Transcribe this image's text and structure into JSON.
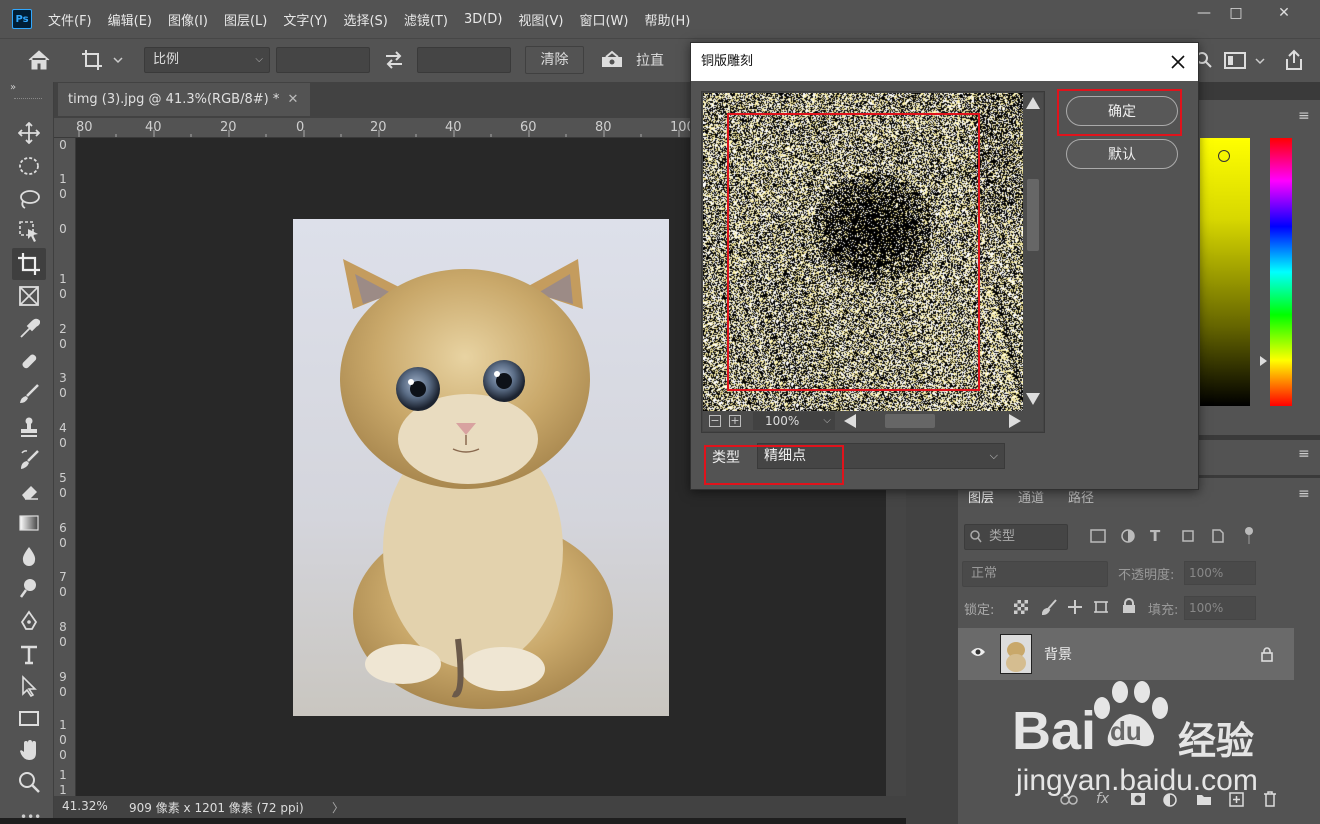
{
  "app": {
    "logo": "Ps",
    "menus": [
      "文件(F)",
      "编辑(E)",
      "图像(I)",
      "图层(L)",
      "文字(Y)",
      "选择(S)",
      "滤镜(T)",
      "3D(D)",
      "视图(V)",
      "窗口(W)",
      "帮助(H)"
    ],
    "window_buttons": [
      "—",
      "□",
      "✕"
    ]
  },
  "options_bar": {
    "ratio_label": "比例",
    "clear_label": "清除",
    "straighten_label": "拉直"
  },
  "document": {
    "tab_title": "timg (3).jpg @ 41.3%(RGB/8#) *",
    "close_glyph": "✕",
    "ruler_top_ticks": [
      "80",
      "40",
      "20",
      "0",
      "20",
      "40",
      "60",
      "80",
      "100"
    ],
    "ruler_left_ticks": [
      "0",
      "1 0",
      "0",
      "1 0",
      "2 0",
      "3 0",
      "4 0",
      "5 0",
      "6 0",
      "7 0",
      "8 0",
      "9 0",
      "1 0 0",
      "1 1"
    ],
    "zoom_status": "41.32%",
    "size_status": "909 像素 x 1201 像素 (72 ppi)",
    "status_arrow": "〉"
  },
  "dialog": {
    "title": "铜版雕刻",
    "ok_label": "确定",
    "default_label": "默认",
    "preview_zoom": "100%",
    "type_label": "类型",
    "type_value": "精细点"
  },
  "layers_panel": {
    "tabs": [
      "图层",
      "通道",
      "路径"
    ],
    "filter_kind": "类型",
    "blend_mode": "正常",
    "opacity_label": "不透明度:",
    "opacity_value": "100%",
    "lock_label": "锁定:",
    "fill_label": "填充:",
    "fill_value": "100%",
    "layer_name": "背景"
  },
  "watermark": {
    "brand": "Bai",
    "brand_suffix": "经验",
    "url": "jingyan.baidu.com"
  },
  "colors": {
    "accent_red": "#e0131c",
    "panel": "#535353",
    "canvas": "#282828"
  }
}
